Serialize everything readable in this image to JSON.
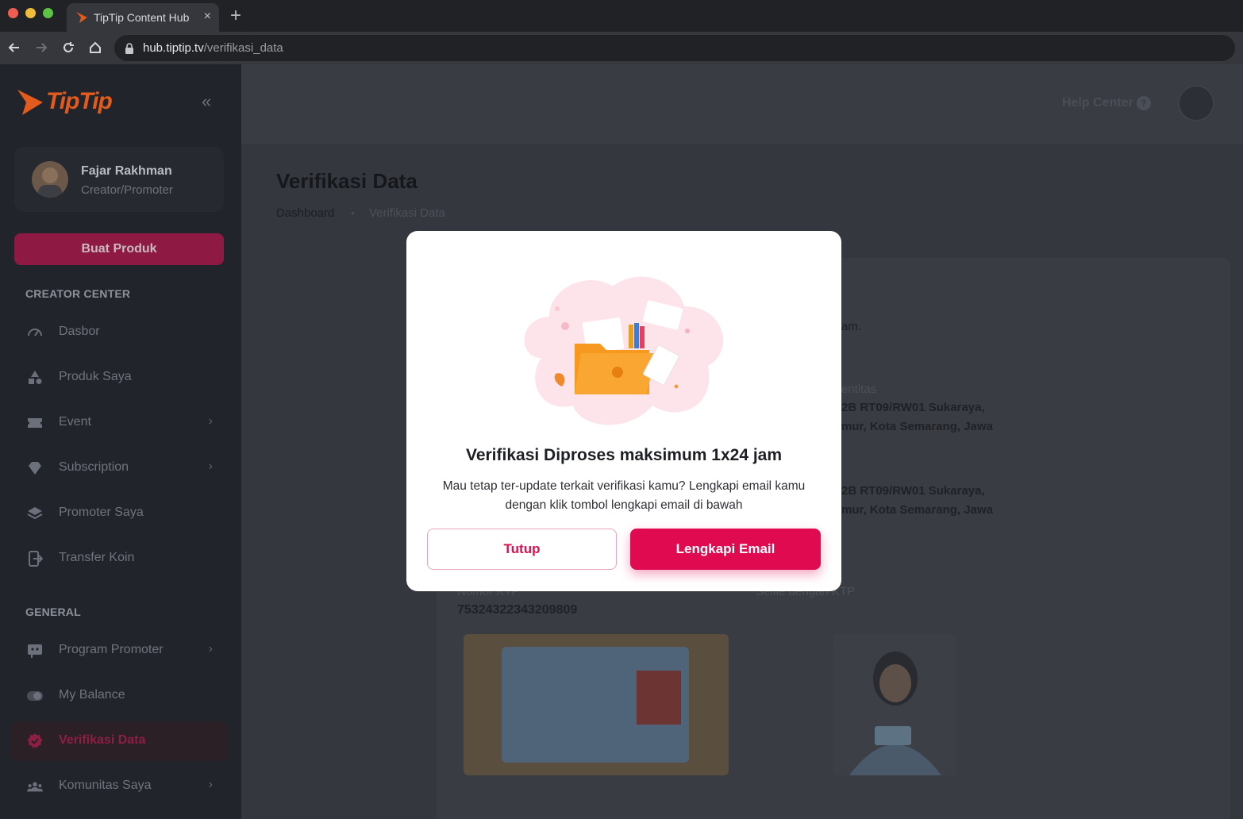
{
  "browser": {
    "tab_title": "TipTip Content Hub",
    "tab_close": "×",
    "new_tab": "+",
    "url_host": "hub.tiptip.tv",
    "url_path": "/verifikasi_data"
  },
  "sidebar": {
    "logo_text": "TipTip",
    "collapse_icon": "«",
    "profile": {
      "name": "Fajar Rakhman",
      "role": "Creator/Promoter"
    },
    "create_button": "Buat Produk",
    "creator_center_title": "CREATOR CENTER",
    "creator_items": [
      {
        "label": "Dasbor",
        "icon": "gauge-icon",
        "chevron": ""
      },
      {
        "label": "Produk Saya",
        "icon": "shapes-icon",
        "chevron": ""
      },
      {
        "label": "Event",
        "icon": "ticket-icon",
        "chevron": "›"
      },
      {
        "label": "Subscription",
        "icon": "diamond-icon",
        "chevron": "›"
      },
      {
        "label": "Promoter Saya",
        "icon": "layers-icon",
        "chevron": ""
      },
      {
        "label": "Transfer Koin",
        "icon": "transfer-icon",
        "chevron": ""
      }
    ],
    "general_title": "GENERAL",
    "general_items": [
      {
        "label": "Program Promoter",
        "icon": "program-icon",
        "chevron": "›"
      },
      {
        "label": "My Balance",
        "icon": "toggle-icon",
        "chevron": ""
      },
      {
        "label": "Verifikasi Data",
        "icon": "verified-badge-icon",
        "chevron": "",
        "active": true
      },
      {
        "label": "Komunitas Saya",
        "icon": "community-icon",
        "chevron": "›"
      }
    ]
  },
  "header": {
    "help": "Help Center",
    "help_icon": "?"
  },
  "page": {
    "title": "Verifikasi Data",
    "breadcrumb": [
      "Dashboard",
      "Verifikasi Data"
    ],
    "breadcrumb_sep": "•"
  },
  "background": {
    "frag_jam": "am.",
    "frag_identitas": "entitas",
    "addr1_line1": "2B RT09/RW01 Sukaraya,",
    "addr1_line2": "mur, Kota Semarang, Jawa",
    "addr2_line1": "2B RT09/RW01 Sukaraya,",
    "addr2_line2": "mur, Kota Semarang, Jawa",
    "nik_label": "Nomor KTP",
    "nik_value": "75324322343209809",
    "selfie_label": "Selfie dengan KTP"
  },
  "modal": {
    "title": "Verifikasi Diproses maksimum 1x24 jam",
    "description": "Mau tetap ter-update terkait verifikasi kamu? Lengkapi email kamu dengan klik tombol lengkapi email di bawah",
    "close_button": "Tutup",
    "email_button": "Lengkapi Email"
  },
  "colors": {
    "brand": "#e25b1c",
    "primary": "#df0a4f",
    "sidebar_bg": "#21242b"
  }
}
